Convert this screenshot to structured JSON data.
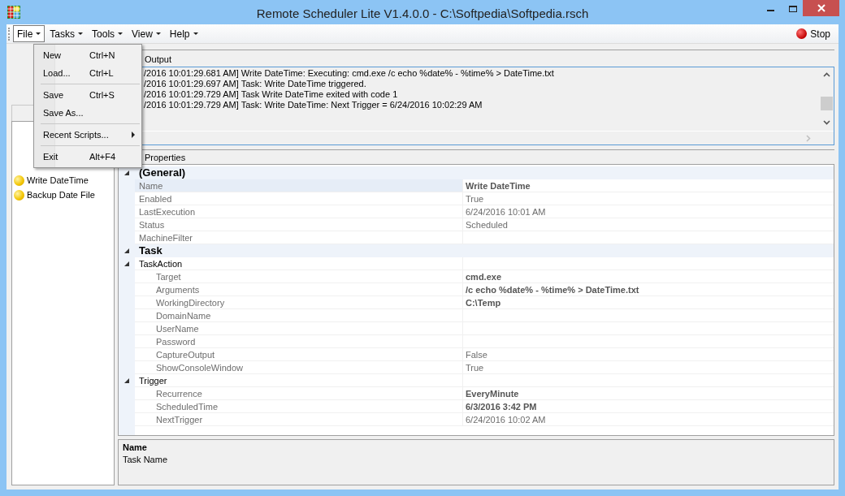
{
  "window": {
    "title": "Remote Scheduler Lite V1.4.0.0 - C:\\Softpedia\\Softpedia.rsch"
  },
  "menu_bar": {
    "items": [
      {
        "label": "File",
        "selected": true
      },
      {
        "label": "Tasks",
        "selected": false
      },
      {
        "label": "Tools",
        "selected": false
      },
      {
        "label": "View",
        "selected": false
      },
      {
        "label": "Help",
        "selected": false
      }
    ],
    "stop_button": {
      "label": "Stop"
    }
  },
  "file_menu": {
    "items": [
      {
        "kind": "item",
        "label": "New",
        "shortcut": "Ctrl+N"
      },
      {
        "kind": "item",
        "label": "Load...",
        "shortcut": "Ctrl+L"
      },
      {
        "kind": "separator"
      },
      {
        "kind": "item",
        "label": "Save",
        "shortcut": "Ctrl+S"
      },
      {
        "kind": "item",
        "label": "Save As..."
      },
      {
        "kind": "separator"
      },
      {
        "kind": "submenu",
        "label": "Recent Scripts..."
      },
      {
        "kind": "separator"
      },
      {
        "kind": "item",
        "label": "Exit",
        "shortcut": "Alt+F4"
      }
    ]
  },
  "task_list": {
    "items": [
      {
        "label": "Write DateTime"
      },
      {
        "label": "Backup Date File"
      }
    ]
  },
  "output": {
    "title": "Output",
    "lines": [
      "/2016 10:01:29.681 AM] Write DateTime: Executing: cmd.exe /c echo %date% - %time% > DateTime.txt",
      "/2016 10:01:29.697 AM] Task: Write DateTime triggered.",
      "/2016 10:01:29.729 AM] Task Write DateTime exited with code 1",
      "/2016 10:01:29.729 AM] Task: Write DateTime: Next Trigger = 6/24/2016 10:02:29 AM"
    ]
  },
  "properties": {
    "title": "Properties",
    "categories": [
      {
        "label": "(General)",
        "expanded": true,
        "children": [
          {
            "label": "Name",
            "value": "Write DateTime",
            "modified": true,
            "selected": true
          },
          {
            "label": "Enabled",
            "value": "True",
            "modified": false,
            "selected": false
          },
          {
            "label": "LastExecution",
            "value": "6/24/2016 10:01 AM",
            "modified": false,
            "selected": false
          },
          {
            "label": "Status",
            "value": "Scheduled",
            "modified": false,
            "selected": false
          },
          {
            "label": "MachineFilter",
            "selected": false
          }
        ]
      },
      {
        "label": "Task",
        "expanded": true,
        "children": [
          {
            "label": "TaskAction",
            "expanded": true,
            "children": [
              {
                "label": "Target",
                "value": "cmd.exe",
                "modified": true,
                "selected": false
              },
              {
                "label": "Arguments",
                "value": "/c echo %date% - %time% > DateTime.txt",
                "modified": true,
                "selected": false
              },
              {
                "label": "WorkingDirectory",
                "value": "C:\\Temp",
                "modified": true,
                "selected": false
              },
              {
                "label": "DomainName",
                "selected": false
              },
              {
                "label": "UserName",
                "selected": false
              },
              {
                "label": "Password",
                "selected": false
              },
              {
                "label": "CaptureOutput",
                "value": "False",
                "modified": false,
                "selected": false
              },
              {
                "label": "ShowConsoleWindow",
                "value": "True",
                "modified": false,
                "selected": false
              }
            ]
          },
          {
            "label": "Trigger",
            "expanded": true,
            "children": [
              {
                "label": "Recurrence",
                "value": "EveryMinute",
                "modified": true,
                "selected": false
              },
              {
                "label": "ScheduledTime",
                "value": "6/3/2016 3:42 PM",
                "modified": true,
                "selected": false
              },
              {
                "label": "NextTrigger",
                "value": "6/24/2016 10:02 AM",
                "modified": false,
                "selected": false
              }
            ]
          }
        ]
      }
    ]
  },
  "description": {
    "title": "Name",
    "text": "Task Name"
  }
}
